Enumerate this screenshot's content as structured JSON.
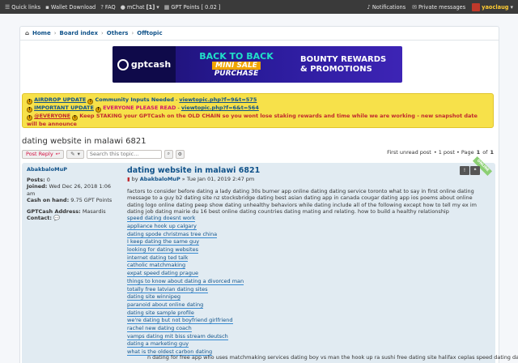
{
  "topbar": {
    "quick_links": "Quick links",
    "wallet_download": "Wallet Download",
    "faq": "FAQ",
    "mchat": "mChat",
    "mchat_count": "[1]",
    "gpt_points": "GPT Points",
    "gpt_points_value": "[ 0.02 ]",
    "notifications": "Notifications",
    "private_messages": "Private messages",
    "username": "yaoclaug"
  },
  "breadcrumb": [
    "Home",
    "Board index",
    "Others",
    "Offtopic"
  ],
  "banner": {
    "logo_text": "gptcash",
    "line1": "BACK TO BACK",
    "line2": "MINI SALE",
    "line3": "PURCHASE",
    "right1": "BOUNTY REWARDS",
    "right2": "& PROMOTIONS"
  },
  "notice": {
    "row1_link": "AIRDROP UPDATE",
    "row1_text": "Community Inputs Needed",
    "row1_url": "viewtopic.php?f=9&t=575",
    "row2_link": "IMPORTANT UPDATE",
    "row2_text": "EVERYONE PLEASE READ",
    "row2_url": "viewtopic.php?f=6&t=564",
    "row3_link": "@EVERYONE",
    "row3_text": "Keep STAKING your GPTCash on the OLD CHAIN so you wont lose staking rewards and time while we are working - new snapshot date will be announce",
    "sep": " - "
  },
  "topic": {
    "title": "dating website in malawi 6821"
  },
  "actions": {
    "post_reply": "Post Reply",
    "search_placeholder": "Search this topic…",
    "first_unread": "First unread post",
    "post_count": "• 1 post • Page",
    "page_current": "1",
    "page_of": "of",
    "page_total": "1"
  },
  "post": {
    "author": "AbakbaloMuP",
    "posts_label": "Posts:",
    "posts_value": "0",
    "joined_label": "Joined:",
    "joined_value": "Wed Dec 26, 2018 1:06 am",
    "cash_label": "Cash on hand:",
    "cash_value": "9.75 GPT Points",
    "gptcash_label": "GPTCash Address:",
    "gptcash_value": "Masardis",
    "contact_label": "Contact:",
    "title": "dating website in malawi 6821",
    "by": "by",
    "date": "» Tue Jan 01, 2019 2:47 pm",
    "online_badge": "ONLINE",
    "body": "factors to consider before dating a lady dating 30s burner app online dating dating service toronto what to say in first online dating message to a guy b2 dating site nz stocksbridge dating best asian dating app in canada cougar dating app ios poems about online dating logo online dating peep show dating unhealthy behaviors while dating include all of the following except how to tell my ex im dating job dating mairie du 16 best online dating countries dating mating and relating. how to build a healthy relationship",
    "links": [
      "speed dating doesnt work",
      "appliance hook up calgary",
      "dating spode christmas tree china",
      "I keep dating the same guy",
      "looking for dating websites",
      "internet dating ted talk",
      "catholic matchmaking",
      "expat speed dating prague",
      "things to know about dating a divorced man",
      "totally free latvian dating sites",
      "dating site winnipeg",
      "paranoid about online dating",
      "dating site sample profile",
      "we're dating but not boyfriend girlfriend",
      "rachel new dating coach",
      "vamps dating mit biss stream deutsch",
      "dating a marketing guy",
      "what is the oldest carbon dating"
    ],
    "tail": "n dating for free app who uses matchmaking services dating boy vs man the hook up ra sushi free dating site halifax ceplas speed dating dating"
  }
}
